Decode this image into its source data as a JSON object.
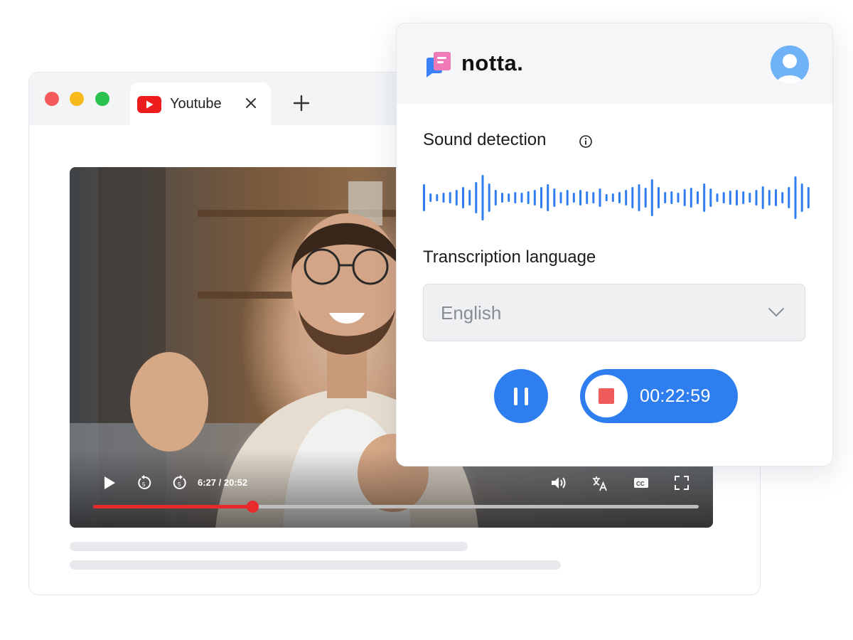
{
  "colors": {
    "accent": "#2f7ef0",
    "progress": "#e82a2a",
    "stop": "#ef5a5a",
    "traffic_red": "#f55a5a",
    "traffic_yellow": "#f8b91a",
    "traffic_green": "#2bc34f"
  },
  "browser": {
    "tab": {
      "label": "Youtube",
      "icon": "youtube-icon"
    },
    "new_tab_icon": "plus-icon"
  },
  "player": {
    "time": "6:27 / 20:52",
    "progress_fraction": 0.263,
    "controls": [
      "play-icon",
      "rewind-5-icon",
      "forward-5-icon",
      "volume-icon",
      "translate-icon",
      "captions-icon",
      "fullscreen-icon"
    ]
  },
  "notta": {
    "brand": "notta.",
    "sound_detection_label": "Sound detection",
    "transcription_language_label": "Transcription language",
    "language": "English",
    "timer": "00:22:59"
  }
}
